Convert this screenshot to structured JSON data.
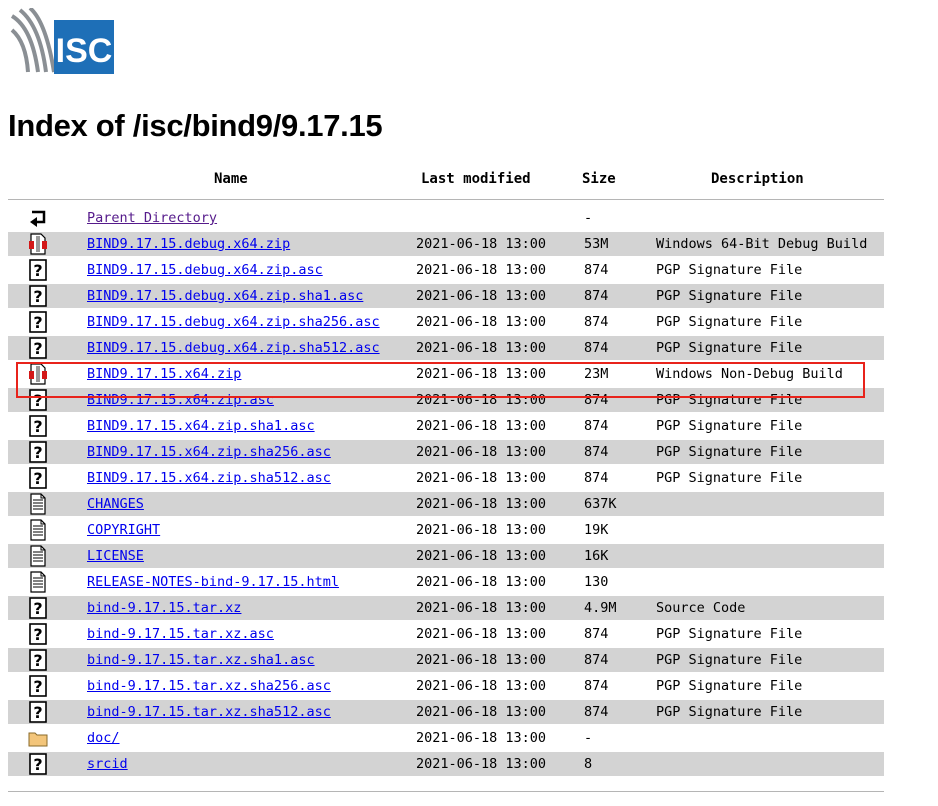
{
  "logo": {
    "text": "ISC",
    "color": "#1e6fb7"
  },
  "page_title": "Index of /isc/bind9/9.17.15",
  "columns": {
    "name": "Name",
    "modified": "Last modified",
    "size": "Size",
    "description": "Description"
  },
  "rows": [
    {
      "icon": "back-icon",
      "name": "Parent Directory",
      "modified": "",
      "size": "-",
      "description": "",
      "visited": true
    },
    {
      "icon": "binary-file-icon",
      "name": "BIND9.17.15.debug.x64.zip",
      "modified": "2021-06-18 13:00",
      "size": "53M",
      "description": "Windows 64-Bit Debug Build"
    },
    {
      "icon": "unknown-file-icon",
      "name": "BIND9.17.15.debug.x64.zip.asc",
      "modified": "2021-06-18 13:00",
      "size": "874",
      "description": "PGP Signature File"
    },
    {
      "icon": "unknown-file-icon",
      "name": "BIND9.17.15.debug.x64.zip.sha1.asc",
      "modified": "2021-06-18 13:00",
      "size": "874",
      "description": "PGP Signature File"
    },
    {
      "icon": "unknown-file-icon",
      "name": "BIND9.17.15.debug.x64.zip.sha256.asc",
      "modified": "2021-06-18 13:00",
      "size": "874",
      "description": "PGP Signature File"
    },
    {
      "icon": "unknown-file-icon",
      "name": "BIND9.17.15.debug.x64.zip.sha512.asc",
      "modified": "2021-06-18 13:00",
      "size": "874",
      "description": "PGP Signature File"
    },
    {
      "icon": "binary-file-icon",
      "name": "BIND9.17.15.x64.zip",
      "modified": "2021-06-18 13:00",
      "size": "23M",
      "description": "Windows Non-Debug Build",
      "highlighted": true
    },
    {
      "icon": "unknown-file-icon",
      "name": "BIND9.17.15.x64.zip.asc",
      "modified": "2021-06-18 13:00",
      "size": "874",
      "description": "PGP Signature File"
    },
    {
      "icon": "unknown-file-icon",
      "name": "BIND9.17.15.x64.zip.sha1.asc",
      "modified": "2021-06-18 13:00",
      "size": "874",
      "description": "PGP Signature File"
    },
    {
      "icon": "unknown-file-icon",
      "name": "BIND9.17.15.x64.zip.sha256.asc",
      "modified": "2021-06-18 13:00",
      "size": "874",
      "description": "PGP Signature File"
    },
    {
      "icon": "unknown-file-icon",
      "name": "BIND9.17.15.x64.zip.sha512.asc",
      "modified": "2021-06-18 13:00",
      "size": "874",
      "description": "PGP Signature File"
    },
    {
      "icon": "text-file-icon",
      "name": "CHANGES",
      "modified": "2021-06-18 13:00",
      "size": "637K",
      "description": ""
    },
    {
      "icon": "text-file-icon",
      "name": "COPYRIGHT",
      "modified": "2021-06-18 13:00",
      "size": "19K",
      "description": ""
    },
    {
      "icon": "text-file-icon",
      "name": "LICENSE",
      "modified": "2021-06-18 13:00",
      "size": "16K",
      "description": ""
    },
    {
      "icon": "text-file-icon",
      "name": "RELEASE-NOTES-bind-9.17.15.html",
      "modified": "2021-06-18 13:00",
      "size": "130",
      "description": ""
    },
    {
      "icon": "unknown-file-icon",
      "name": "bind-9.17.15.tar.xz",
      "modified": "2021-06-18 13:00",
      "size": "4.9M",
      "description": "Source Code"
    },
    {
      "icon": "unknown-file-icon",
      "name": "bind-9.17.15.tar.xz.asc",
      "modified": "2021-06-18 13:00",
      "size": "874",
      "description": "PGP Signature File"
    },
    {
      "icon": "unknown-file-icon",
      "name": "bind-9.17.15.tar.xz.sha1.asc",
      "modified": "2021-06-18 13:00",
      "size": "874",
      "description": "PGP Signature File"
    },
    {
      "icon": "unknown-file-icon",
      "name": "bind-9.17.15.tar.xz.sha256.asc",
      "modified": "2021-06-18 13:00",
      "size": "874",
      "description": "PGP Signature File"
    },
    {
      "icon": "unknown-file-icon",
      "name": "bind-9.17.15.tar.xz.sha512.asc",
      "modified": "2021-06-18 13:00",
      "size": "874",
      "description": "PGP Signature File"
    },
    {
      "icon": "folder-icon",
      "name": "doc/",
      "modified": "2021-06-18 13:00",
      "size": "-",
      "description": ""
    },
    {
      "icon": "unknown-file-icon",
      "name": "srcid",
      "modified": "2021-06-18 13:00",
      "size": "8",
      "description": ""
    }
  ]
}
